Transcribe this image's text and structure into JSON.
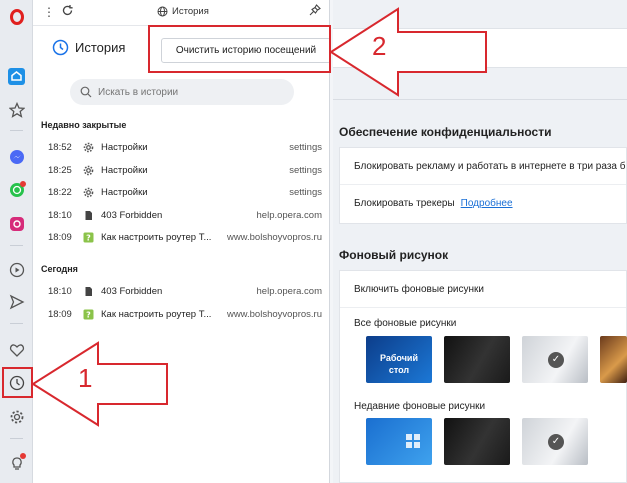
{
  "sidebar": {
    "icons": [
      "opera-logo-icon",
      "home-icon",
      "star-icon",
      "messenger-icon",
      "whatsapp-icon",
      "instagram-icon",
      "player-icon",
      "send-icon",
      "heart-icon",
      "clock-icon",
      "gear-icon",
      "lightbulb-icon"
    ]
  },
  "panel": {
    "tab_title": "История",
    "title": "История",
    "clear_button": "Очистить историю посещений",
    "search_placeholder": "Искать в истории",
    "groups": [
      {
        "title": "Недавно закрытые",
        "rows": [
          {
            "time": "18:52",
            "icon": "gear-icon",
            "name": "Настройки",
            "domain": "settings"
          },
          {
            "time": "18:25",
            "icon": "gear-icon",
            "name": "Настройки",
            "domain": "settings"
          },
          {
            "time": "18:22",
            "icon": "gear-icon",
            "name": "Настройки",
            "domain": "settings"
          },
          {
            "time": "18:10",
            "icon": "file-icon",
            "name": "403 Forbidden",
            "domain": "help.opera.com"
          },
          {
            "time": "18:09",
            "icon": "site-favicon-icon",
            "name": "Как настроить роутер Т...",
            "domain": "www.bolshoyvopros.ru"
          }
        ]
      },
      {
        "title": "Сегодня",
        "rows": [
          {
            "time": "18:10",
            "icon": "file-icon",
            "name": "403 Forbidden",
            "domain": "help.opera.com"
          },
          {
            "time": "18:09",
            "icon": "site-favicon-icon",
            "name": "Как настроить роутер Т...",
            "domain": "www.bolshoyvopros.ru"
          }
        ]
      }
    ]
  },
  "settings": {
    "privacy_title": "Обеспечение конфиденциальности",
    "adblock_text": "Блокировать рекламу и работать в интернете в три раза быс",
    "trackers_text": "Блокировать трекеры",
    "trackers_link": "Подробнее",
    "wallpaper_title": "Фоновый рисунок",
    "enable_wallpapers": "Включить фоновые рисунки",
    "all_wallpapers": "Все фоновые рисунки",
    "desktop_label": "Рабочий стол",
    "recent_wallpapers": "Недавние фоновые рисунки"
  },
  "annotations": {
    "label_1": "1",
    "label_2": "2",
    "color": "#d8282e"
  }
}
